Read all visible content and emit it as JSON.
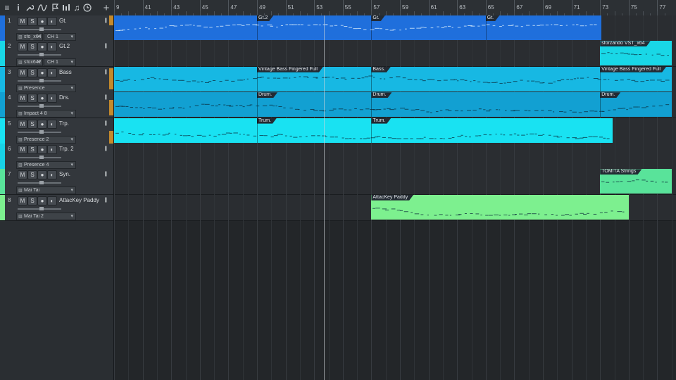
{
  "toolbar": {
    "tools": [
      "menu-icon",
      "info-icon",
      "wrench-icon",
      "curve-icon",
      "flag-icon",
      "mixer-icon",
      "note-icon",
      "clock-icon",
      "add-icon"
    ]
  },
  "ruler": {
    "bars": [
      {
        "num": "9"
      },
      {
        "num": "41"
      },
      {
        "num": "43"
      },
      {
        "num": "45"
      },
      {
        "num": "47"
      },
      {
        "num": "49"
      },
      {
        "num": "51"
      },
      {
        "num": "53"
      },
      {
        "num": "55"
      },
      {
        "num": "57"
      },
      {
        "num": "59"
      },
      {
        "num": "61"
      },
      {
        "num": "63"
      },
      {
        "num": "65"
      },
      {
        "num": "67"
      },
      {
        "num": "69"
      },
      {
        "num": "71"
      },
      {
        "num": "73"
      },
      {
        "num": "75"
      },
      {
        "num": "77"
      }
    ]
  },
  "track_header": {
    "mute": "M",
    "solo": "S",
    "rec": "●",
    "monitor": "◐",
    "keys": "|||"
  },
  "tracks": [
    {
      "num": "1",
      "name": "Gt.",
      "instrument": "sfo_x64",
      "channel": "CH 1",
      "color": "#1f6fdc"
    },
    {
      "num": "2",
      "name": "Gt.2",
      "instrument": "sfox642",
      "channel": "CH 1",
      "color": "#19d7e6"
    },
    {
      "num": "3",
      "name": "Bass",
      "instrument": "Presence",
      "channel": "",
      "color": "#17b8e3"
    },
    {
      "num": "4",
      "name": "Drs.",
      "instrument": "Impact 4 8",
      "channel": "",
      "color": "#12a0d2"
    },
    {
      "num": "5",
      "name": "Trp.",
      "instrument": "Presence 2",
      "channel": "",
      "color": "#19e2f2"
    },
    {
      "num": "6",
      "name": "Trp. 2",
      "instrument": "Presence 4",
      "channel": "",
      "color": "#18d2e6"
    },
    {
      "num": "7",
      "name": "Syn.",
      "instrument": "Mai Tai",
      "channel": "",
      "color": "#59e39a"
    },
    {
      "num": "8",
      "name": "AttacKey Paddy",
      "instrument": "Mai Tai 2",
      "channel": "",
      "color": "#7df08f"
    }
  ],
  "clips": [
    {
      "track": 0,
      "start": 39,
      "end": 73.1,
      "color": "#1f6fdc",
      "segments": [
        {
          "at": 49,
          "label": "Gt.2"
        },
        {
          "at": 57,
          "label": "Gt."
        },
        {
          "at": 65,
          "label": "Gt."
        }
      ]
    },
    {
      "track": 1,
      "start": 73.0,
      "end": 78,
      "color": "#19d7e6",
      "segments": [
        {
          "at": 73,
          "label": "sforzando VST_x64"
        }
      ]
    },
    {
      "track": 2,
      "start": 39,
      "end": 78,
      "color": "#17b8e3",
      "segments": [
        {
          "at": 49,
          "label": "Vintage Bass Fingered Full"
        },
        {
          "at": 57,
          "label": "Bass."
        },
        {
          "at": 73,
          "label": "Vintage Bass Fingered Full"
        }
      ]
    },
    {
      "track": 3,
      "start": 39,
      "end": 78,
      "color": "#12a0d2",
      "segments": [
        {
          "at": 49,
          "label": "Drum."
        },
        {
          "at": 57,
          "label": "Drum."
        },
        {
          "at": 73,
          "label": "Drum."
        }
      ]
    },
    {
      "track": 4,
      "start": 39,
      "end": 73.9,
      "color": "#19e2f2",
      "segments": [
        {
          "at": 49,
          "label": "Trum."
        },
        {
          "at": 57,
          "label": "Trum."
        }
      ]
    },
    {
      "track": 6,
      "start": 73.0,
      "end": 78,
      "color": "#59e39a",
      "segments": [
        {
          "at": 73,
          "label": "TOMITA Strings"
        }
      ]
    },
    {
      "track": 7,
      "start": 57,
      "end": 75.0,
      "color": "#7df08f",
      "segments": [
        {
          "at": 57,
          "label": "AttacKey Paddy"
        }
      ]
    }
  ],
  "transport": {
    "playhead_bar": 53.7
  },
  "colors": {
    "accent_record": "#c48a2c",
    "background": "#232629"
  }
}
